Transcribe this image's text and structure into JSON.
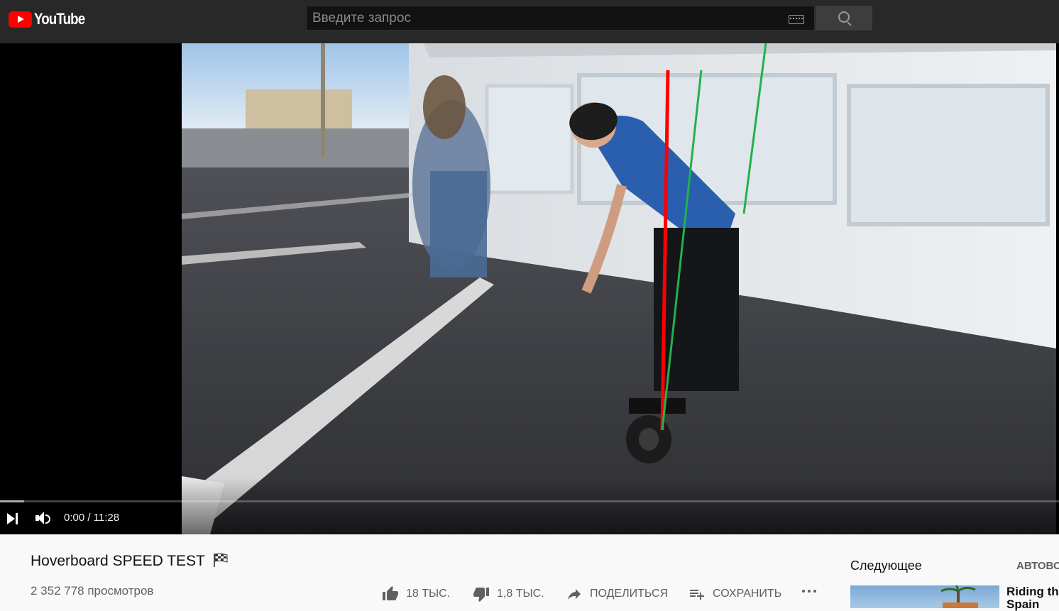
{
  "app": {
    "logo_text": "YouTube"
  },
  "search": {
    "placeholder": "Введите запрос"
  },
  "player": {
    "time": "0:00 / 11:28",
    "progress": 0.0
  },
  "video": {
    "title": "Hoverboard SPEED TEST",
    "views": "2 352 778 просмотров"
  },
  "actions": {
    "likes": "18 ТЫС.",
    "dislikes": "1,8 ТЫС.",
    "share": "ПОДЕЛИТЬСЯ",
    "save": "СОХРАНИТЬ"
  },
  "sidebar": {
    "up_next": "Следующее",
    "autoplay": "АВТОВО",
    "next_title_line1": "Riding the",
    "next_title_line2": "Spain"
  },
  "annotations": {
    "colors": {
      "vertical_line": "#ff0000",
      "tilt_lines": "#22b14c"
    }
  }
}
